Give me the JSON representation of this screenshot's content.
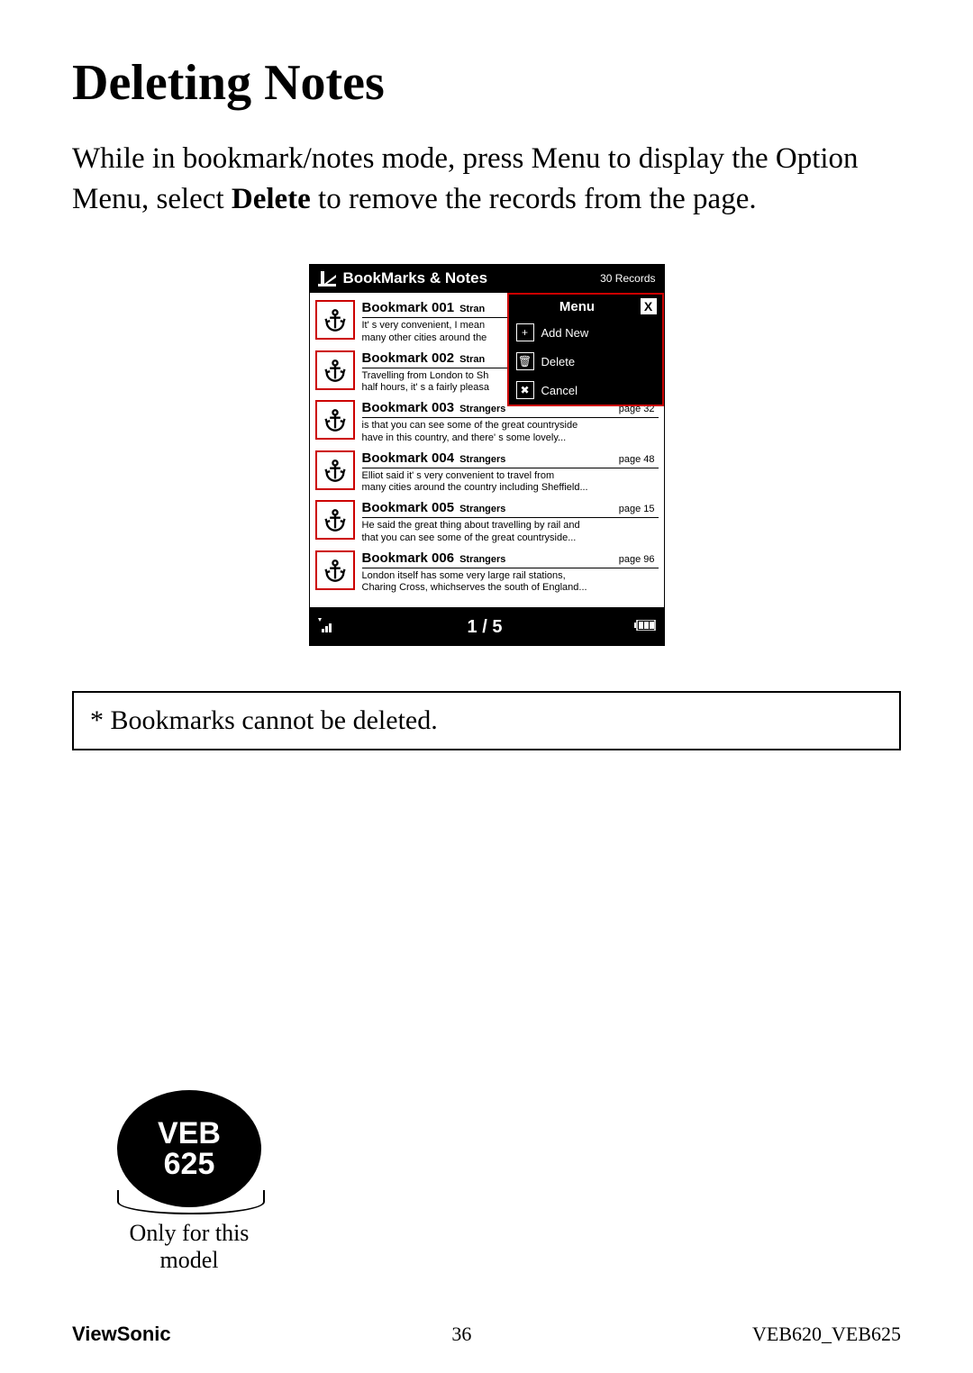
{
  "doc": {
    "title": "Deleting Notes",
    "body_before": "While in bookmark/notes mode, press Menu to display the Option Menu, select ",
    "body_bold": "Delete",
    "body_after": " to remove the records from the page.",
    "notice": "* Bookmarks cannot be deleted.",
    "model_line1": "VEB",
    "model_line2": "625",
    "model_caption": "Only for this model",
    "footer_left": "ViewSonic",
    "footer_center": "36",
    "footer_right": "VEB620_VEB625"
  },
  "device": {
    "header_title": "BookMarks & Notes",
    "header_count": "30 Records",
    "pager": "1 / 5",
    "menu": {
      "title": "Menu",
      "close": "X",
      "items": [
        {
          "icon": "+",
          "label": "Add New",
          "name": "menu-item-add-new"
        },
        {
          "icon": "🗑",
          "label": "Delete",
          "name": "menu-item-delete"
        },
        {
          "icon": "✖",
          "label": "Cancel",
          "name": "menu-item-cancel"
        }
      ]
    },
    "bookmarks": [
      {
        "title": "Bookmark 001",
        "source": "Stran",
        "page": "",
        "text": "It' s very convenient, I mean\nmany other cities around the"
      },
      {
        "title": "Bookmark 002",
        "source": "Stran",
        "page": "",
        "text": "Travelling from London to Sh\nhalf hours, it' s a fairly pleasa"
      },
      {
        "title": "Bookmark 003",
        "source": "Strangers",
        "page": "page 32",
        "text": "is that you can see some of the great countryside\nhave in this country, and there' s some lovely..."
      },
      {
        "title": "Bookmark 004",
        "source": "Strangers",
        "page": "page 48",
        "text": "Elliot said it' s very convenient to travel from\nmany cities around the country including Sheffield..."
      },
      {
        "title": "Bookmark 005",
        "source": "Strangers",
        "page": "page 15",
        "text": "He said the great thing about travelling by rail and\nthat you can see some of the great countryside..."
      },
      {
        "title": "Bookmark 006",
        "source": "Strangers",
        "page": "page 96",
        "text": "London itself has some very large rail stations,\nCharing Cross, whichserves the south of England..."
      }
    ]
  }
}
